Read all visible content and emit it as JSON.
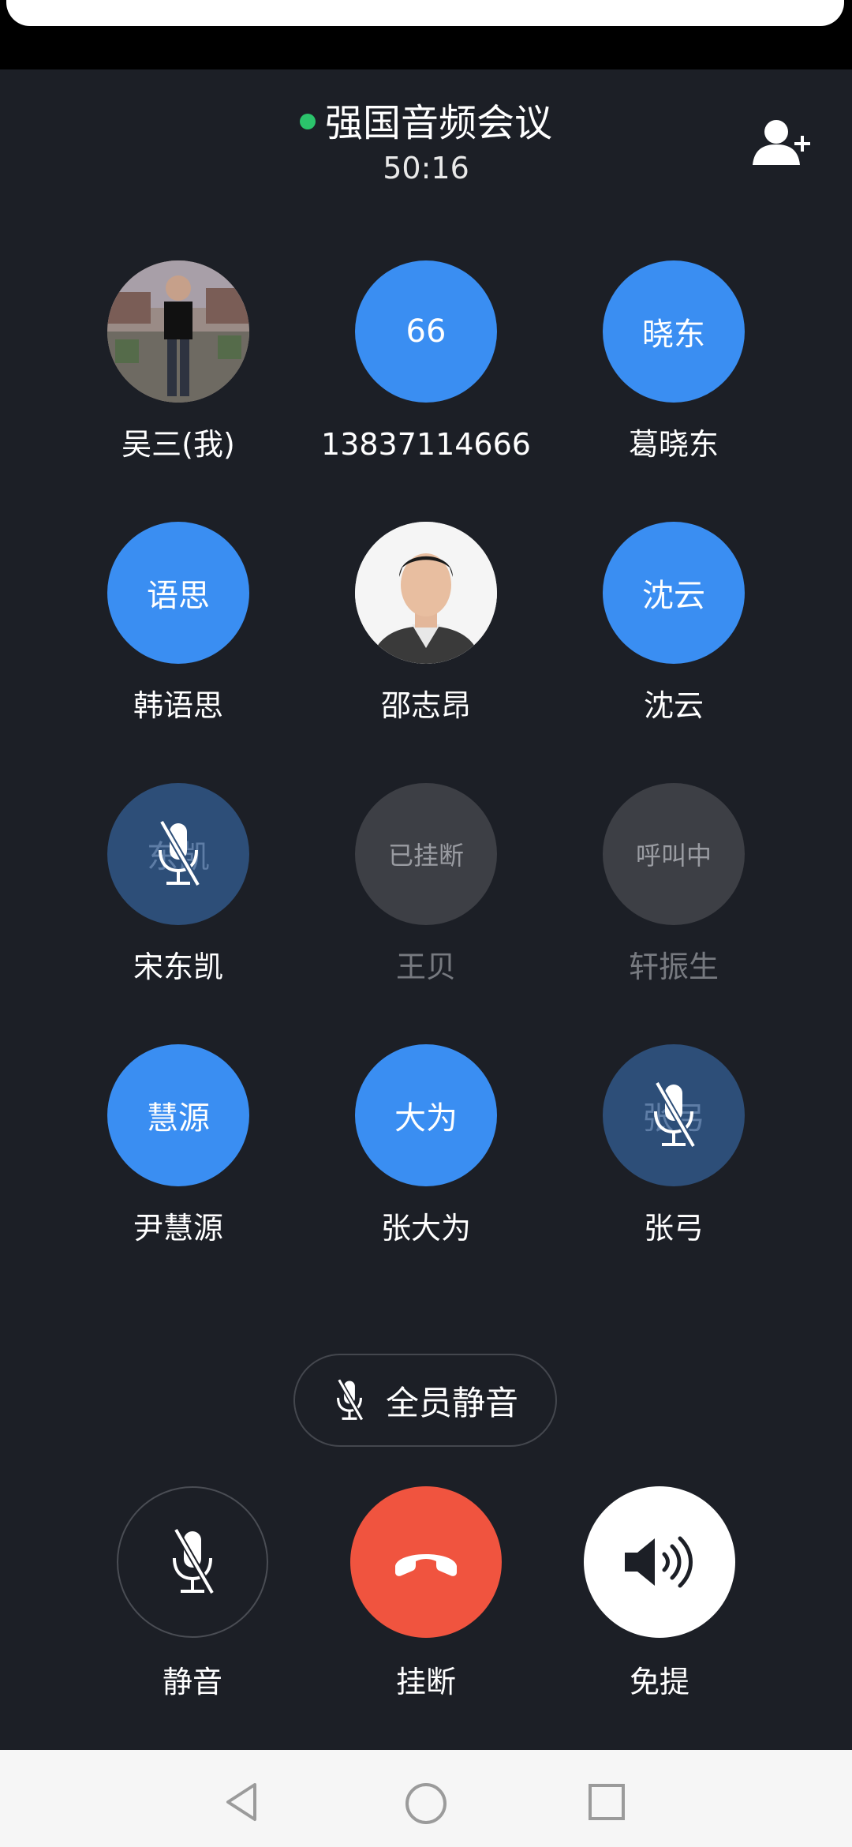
{
  "header": {
    "title": "强国音频会议",
    "timer": "50:16",
    "add_icon": "add-person-icon",
    "status_color": "#2bc36b"
  },
  "participants": [
    {
      "avatar_text": "",
      "name": "吴三(我)",
      "state": "photo"
    },
    {
      "avatar_text": "66",
      "name": "13837114666",
      "state": "active"
    },
    {
      "avatar_text": "晓东",
      "name": "葛晓东",
      "state": "active"
    },
    {
      "avatar_text": "语思",
      "name": "韩语思",
      "state": "active"
    },
    {
      "avatar_text": "",
      "name": "邵志昂",
      "state": "photo"
    },
    {
      "avatar_text": "沈云",
      "name": "沈云",
      "state": "active"
    },
    {
      "avatar_text": "东凯",
      "name": "宋东凯",
      "state": "muted"
    },
    {
      "avatar_text": "已挂断",
      "name": "王贝",
      "state": "hung-up"
    },
    {
      "avatar_text": "呼叫中",
      "name": "轩振生",
      "state": "calling"
    },
    {
      "avatar_text": "慧源",
      "name": "尹慧源",
      "state": "active"
    },
    {
      "avatar_text": "大为",
      "name": "张大为",
      "state": "active"
    },
    {
      "avatar_text": "张弓",
      "name": "张弓",
      "state": "muted"
    }
  ],
  "controls": {
    "mute_all": "全员静音",
    "mute": "静音",
    "hangup": "挂断",
    "speaker": "免提",
    "hangup_color": "#f0543f",
    "accent": "#3a8ef2"
  },
  "navbar": {
    "back_icon": "back-triangle-icon",
    "home_icon": "home-circle-icon",
    "recents_icon": "recents-square-icon"
  }
}
